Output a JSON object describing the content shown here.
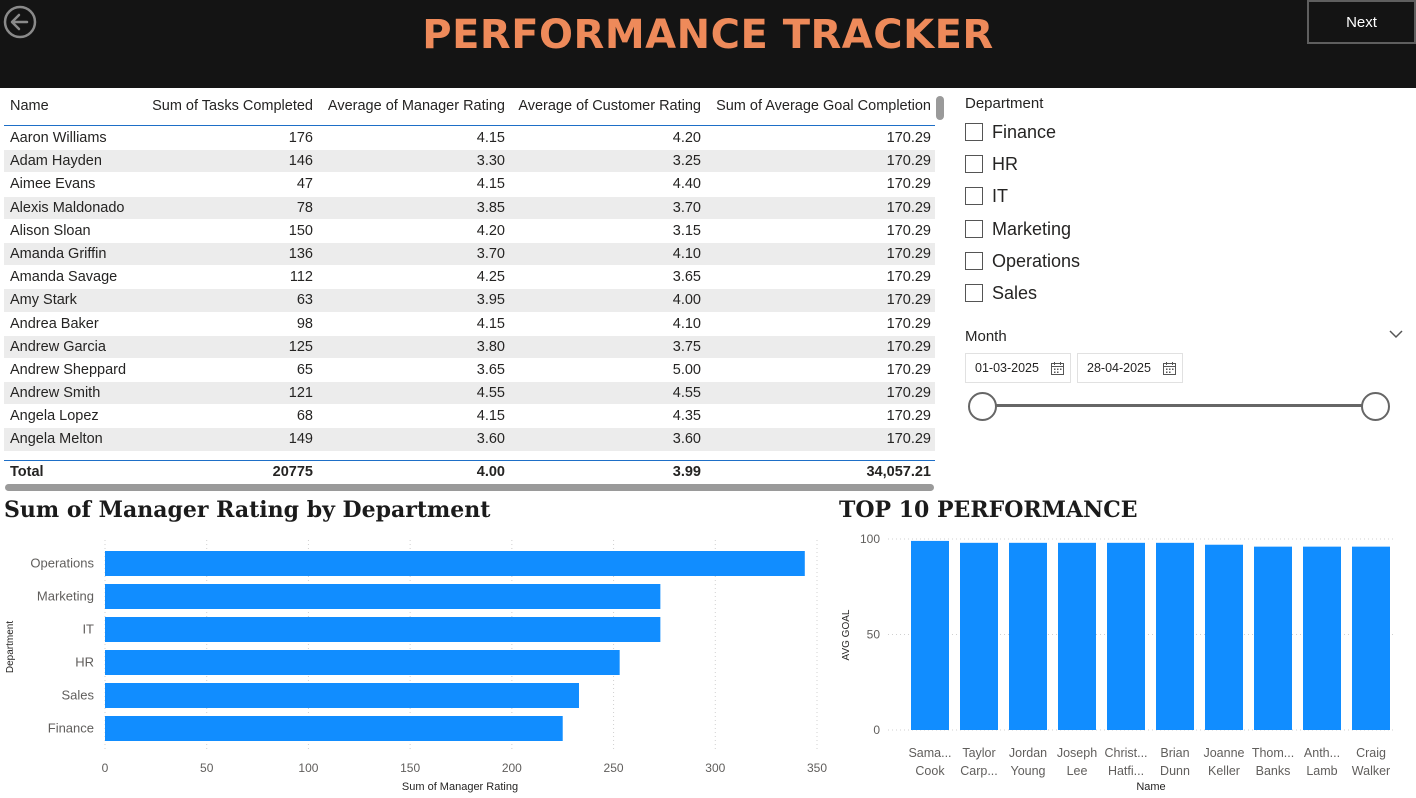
{
  "header": {
    "title": "PERFORMANCE TRACKER",
    "next_label": "Next"
  },
  "table": {
    "columns": [
      "Name",
      "Sum of Tasks Completed",
      "Average of Manager Rating",
      "Average of Customer Rating",
      "Sum of Average Goal Completion"
    ],
    "rows": [
      [
        "Aaron Williams",
        "176",
        "4.15",
        "4.20",
        "170.29"
      ],
      [
        "Adam Hayden",
        "146",
        "3.30",
        "3.25",
        "170.29"
      ],
      [
        "Aimee Evans",
        "47",
        "4.15",
        "4.40",
        "170.29"
      ],
      [
        "Alexis Maldonado",
        "78",
        "3.85",
        "3.70",
        "170.29"
      ],
      [
        "Alison Sloan",
        "150",
        "4.20",
        "3.15",
        "170.29"
      ],
      [
        "Amanda Griffin",
        "136",
        "3.70",
        "4.10",
        "170.29"
      ],
      [
        "Amanda Savage",
        "112",
        "4.25",
        "3.65",
        "170.29"
      ],
      [
        "Amy Stark",
        "63",
        "3.95",
        "4.00",
        "170.29"
      ],
      [
        "Andrea Baker",
        "98",
        "4.15",
        "4.10",
        "170.29"
      ],
      [
        "Andrew Garcia",
        "125",
        "3.80",
        "3.75",
        "170.29"
      ],
      [
        "Andrew Sheppard",
        "65",
        "3.65",
        "5.00",
        "170.29"
      ],
      [
        "Andrew Smith",
        "121",
        "4.55",
        "4.55",
        "170.29"
      ],
      [
        "Angela Lopez",
        "68",
        "4.15",
        "4.35",
        "170.29"
      ],
      [
        "Angela Melton",
        "149",
        "3.60",
        "3.60",
        "170.29"
      ]
    ],
    "total": [
      "Total",
      "20775",
      "4.00",
      "3.99",
      "34,057.21"
    ]
  },
  "department_slicer": {
    "title": "Department",
    "options": [
      "Finance",
      "HR",
      "IT",
      "Marketing",
      "Operations",
      "Sales"
    ]
  },
  "month_slicer": {
    "title": "Month",
    "start_date": "01-03-2025",
    "end_date": "28-04-2025",
    "range_start": 0,
    "range_end": 1
  },
  "charts": {
    "dept_title": "Sum of Manager Rating by Department",
    "top10_title": "TOP 10 PERFORMANCE"
  },
  "chart_data": [
    {
      "type": "bar",
      "orientation": "horizontal",
      "title": "Sum of Manager Rating by Department",
      "categories": [
        "Operations",
        "Marketing",
        "IT",
        "HR",
        "Sales",
        "Finance"
      ],
      "values": [
        344,
        273,
        273,
        253,
        233,
        225
      ],
      "xlabel": "Sum of Manager Rating",
      "ylabel": "Department",
      "xlim": [
        0,
        350
      ],
      "xticks": [
        0,
        50,
        100,
        150,
        200,
        250,
        300,
        350
      ],
      "grid": true,
      "color": "#118dff"
    },
    {
      "type": "bar",
      "orientation": "vertical",
      "title": "TOP 10 PERFORMANCE",
      "categories": [
        [
          "Sama...",
          "Cook"
        ],
        [
          "Taylor",
          "Carp..."
        ],
        [
          "Jordan",
          "Young"
        ],
        [
          "Joseph",
          "Lee"
        ],
        [
          "Christ...",
          "Hatfi..."
        ],
        [
          "Brian",
          "Dunn"
        ],
        [
          "Joanne",
          "Keller"
        ],
        [
          "Thom...",
          "Banks"
        ],
        [
          "Anth...",
          "Lamb"
        ],
        [
          "Craig",
          "Walker"
        ]
      ],
      "values": [
        99,
        98,
        98,
        98,
        98,
        98,
        97,
        96,
        96,
        96
      ],
      "xlabel": "Name",
      "ylabel": "AVG GOAL",
      "ylim": [
        0,
        100
      ],
      "yticks": [
        0,
        50,
        100
      ],
      "grid": true,
      "color": "#118dff"
    }
  ]
}
